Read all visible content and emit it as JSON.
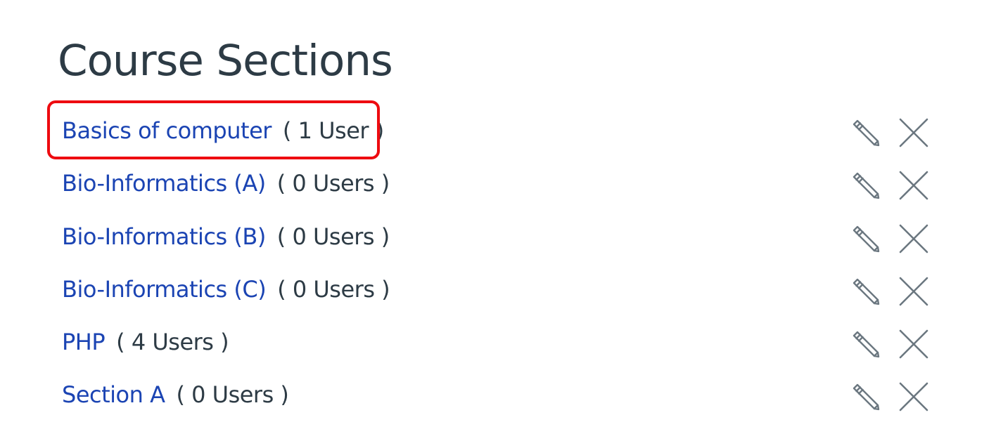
{
  "page": {
    "title": "Course Sections"
  },
  "sections": [
    {
      "name": "Basics of computer",
      "users": "( 1 User )",
      "highlighted": true
    },
    {
      "name": "Bio-Informatics (A)",
      "users": "( 0 Users )",
      "highlighted": false
    },
    {
      "name": "Bio-Informatics (B)",
      "users": "( 0 Users )",
      "highlighted": false
    },
    {
      "name": "Bio-Informatics (C)",
      "users": "( 0 Users )",
      "highlighted": false
    },
    {
      "name": "PHP",
      "users": "( 4 Users )",
      "highlighted": false
    },
    {
      "name": "Section A",
      "users": "( 0 Users )",
      "highlighted": false
    }
  ],
  "icons": {
    "edit": "pencil-icon",
    "delete": "close-icon"
  },
  "colors": {
    "link": "#1b44b3",
    "text": "#2d3b45",
    "icon": "#6b7780",
    "highlight": "#ee0b10"
  }
}
